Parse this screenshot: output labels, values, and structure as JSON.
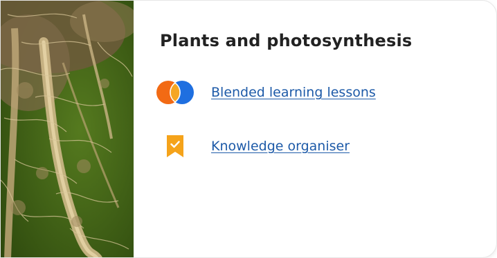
{
  "card": {
    "title": "Plants and photosynthesis",
    "image": {
      "subject": "plant roots"
    },
    "resources": [
      {
        "label": "Blended learning lessons",
        "icon": "blended-learning-icon"
      },
      {
        "label": "Knowledge organiser",
        "icon": "bookmark-check-icon"
      }
    ]
  },
  "colors": {
    "title": "#222222",
    "link": "#1d5aa8",
    "blend_orange": "#f26a14",
    "blend_blue": "#1f6fe0",
    "blend_overlap": "#f5a623",
    "bookmark": "#f5a31a"
  }
}
